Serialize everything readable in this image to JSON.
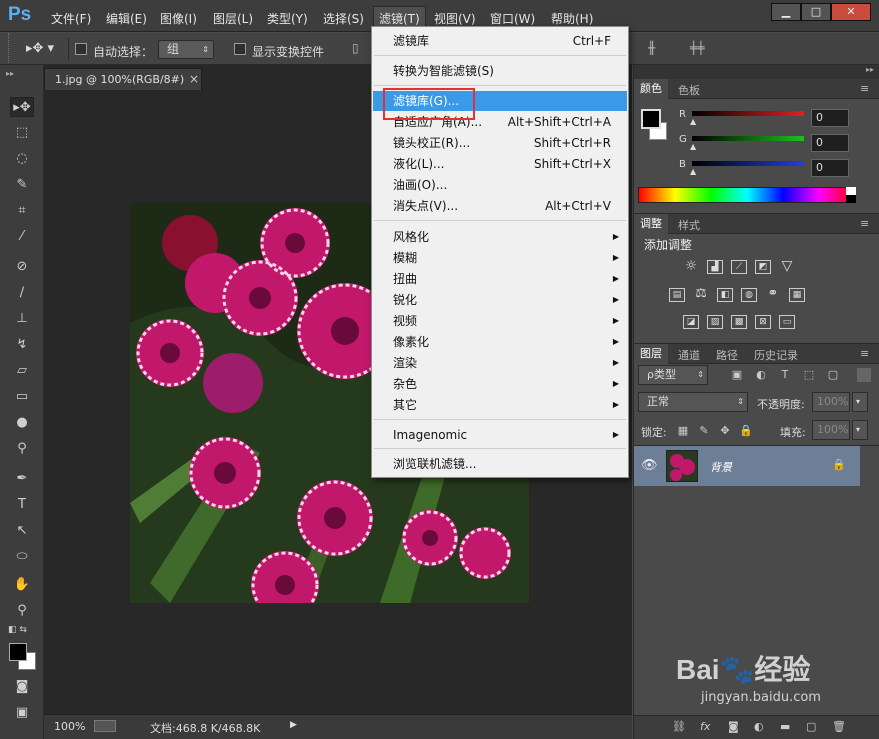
{
  "app": {
    "logo": "Ps"
  },
  "menubar": {
    "items": [
      "文件(F)",
      "编辑(E)",
      "图像(I)",
      "图层(L)",
      "类型(Y)",
      "选择(S)",
      "滤镜(T)",
      "视图(V)",
      "窗口(W)",
      "帮助(H)"
    ],
    "active": "滤镜(T)"
  },
  "window_controls": {
    "minimize": "▁",
    "maximize": "□",
    "close": "✕"
  },
  "options": {
    "auto_select_label": "自动选择：",
    "auto_select_value": "组",
    "show_transform_label": "显示变换控件"
  },
  "document": {
    "tab_title": "1.jpg @ 100%(RGB/8#)",
    "tab_close": "×",
    "zoom": "100%",
    "doc_size": "文档:468.8 K/468.8K",
    "photo_name": "背景"
  },
  "filter_menu": {
    "items": [
      {
        "label": "滤镜库",
        "shortcut": "Ctrl+F"
      },
      {
        "label": "转换为智能滤镜(S)"
      },
      {
        "label": "滤镜库(G)...",
        "highlight": true
      },
      {
        "label": "自适应广角(A)...",
        "shortcut": "Alt+Shift+Ctrl+A"
      },
      {
        "label": "镜头校正(R)...",
        "shortcut": "Shift+Ctrl+R"
      },
      {
        "label": "液化(L)...",
        "shortcut": "Shift+Ctrl+X"
      },
      {
        "label": "油画(O)..."
      },
      {
        "label": "消失点(V)...",
        "shortcut": "Alt+Ctrl+V"
      },
      {
        "label": "风格化",
        "submenu": true
      },
      {
        "label": "模糊",
        "submenu": true
      },
      {
        "label": "扭曲",
        "submenu": true
      },
      {
        "label": "锐化",
        "submenu": true
      },
      {
        "label": "视频",
        "submenu": true
      },
      {
        "label": "像素化",
        "submenu": true
      },
      {
        "label": "渲染",
        "submenu": true
      },
      {
        "label": "杂色",
        "submenu": true
      },
      {
        "label": "其它",
        "submenu": true
      },
      {
        "label": "Imagenomic",
        "submenu": true
      },
      {
        "label": "浏览联机滤镜..."
      }
    ]
  },
  "color_panel": {
    "tabs": [
      "颜色",
      "色板"
    ],
    "channels": [
      {
        "label": "R",
        "value": "0",
        "color": "#e02020"
      },
      {
        "label": "G",
        "value": "0",
        "color": "#20c020"
      },
      {
        "label": "B",
        "value": "0",
        "color": "#2040e0"
      }
    ]
  },
  "adjust_panel": {
    "tabs": [
      "调整",
      "样式"
    ],
    "title": "添加调整"
  },
  "layers_panel": {
    "tabs": [
      "图层",
      "通道",
      "路径",
      "历史记录"
    ],
    "filter_type": "ρ类型",
    "blend_mode": "正常",
    "opacity_label": "不透明度:",
    "opacity_value": "100%",
    "lock_label": "锁定:",
    "fill_label": "填充:",
    "fill_value": "100%"
  },
  "watermark": {
    "text": "Bai🐾经验",
    "url": "jingyan.baidu.com"
  }
}
